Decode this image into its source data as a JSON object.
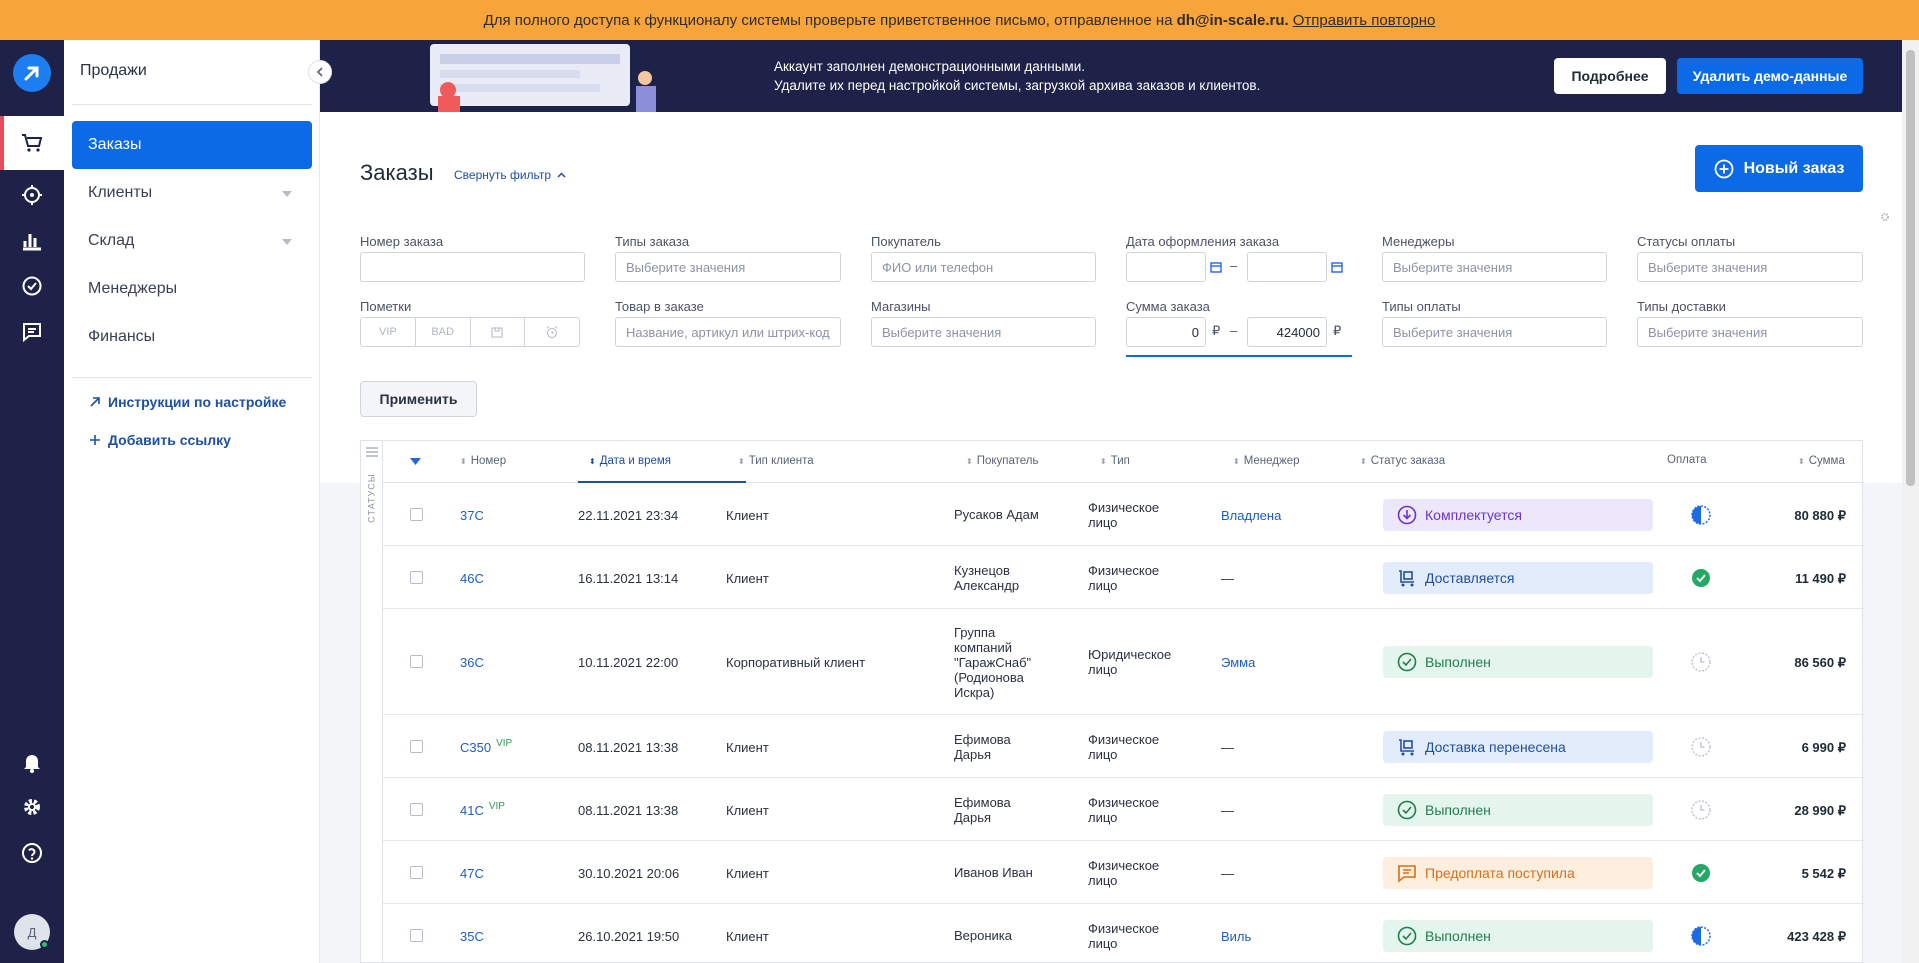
{
  "notice": {
    "text": "Для полного доступа к функционалу системы проверьте приветственное письмо, отправленное на",
    "email": "dh@in-scale.ru.",
    "resend": "Отправить повторно"
  },
  "sidebar": {
    "section": "Продажи",
    "items": [
      {
        "label": "Заказы"
      },
      {
        "label": "Клиенты"
      },
      {
        "label": "Склад"
      },
      {
        "label": "Менеджеры"
      },
      {
        "label": "Финансы"
      }
    ],
    "links": [
      {
        "label": "Инструкции по настройке"
      },
      {
        "label": "Добавить ссылку"
      }
    ]
  },
  "rail": {
    "avatar": "Д"
  },
  "banner": {
    "line1": "Аккаунт заполнен демонстрационными данными.",
    "line2": "Удалите их перед настройкой системы, загрузкой архива заказов и клиентов.",
    "more": "Подробнее",
    "delete": "Удалить демо-данные"
  },
  "page": {
    "title": "Заказы",
    "filter_toggle": "Свернуть фильтр",
    "new_order": "Новый заказ"
  },
  "filters": {
    "order_number": {
      "label": "Номер заказа",
      "placeholder": ""
    },
    "order_types": {
      "label": "Типы заказа",
      "placeholder": "Выберите значения"
    },
    "buyer": {
      "label": "Покупатель",
      "placeholder": "ФИО или телефон"
    },
    "date": {
      "label": "Дата оформления заказа",
      "sep": "–"
    },
    "managers": {
      "label": "Менеджеры",
      "placeholder": "Выберите значения"
    },
    "pay_statuses": {
      "label": "Статусы оплаты",
      "placeholder": "Выберите значения"
    },
    "marks": {
      "label": "Пометки",
      "vip": "VIP",
      "bad": "BAD"
    },
    "product": {
      "label": "Товар в заказе",
      "placeholder": "Название, артикул или штрих-код"
    },
    "shops": {
      "label": "Магазины",
      "placeholder": "Выберите значения"
    },
    "sum": {
      "label": "Сумма заказа",
      "from": "0",
      "to": "424000",
      "currency": "₽",
      "sep": "–"
    },
    "pay_types": {
      "label": "Типы оплаты",
      "placeholder": "Выберите значения"
    },
    "delivery_types": {
      "label": "Типы доставки",
      "placeholder": "Выберите значения"
    },
    "apply": "Применить"
  },
  "table": {
    "status_col": "СТАТУСЫ",
    "headers": {
      "number": "Номер",
      "datetime": "Дата и время",
      "client_type": "Тип клиента",
      "buyer": "Покупатель",
      "type": "Тип",
      "manager": "Менеджер",
      "status": "Статус заказа",
      "payment": "Оплата",
      "sum": "Сумма"
    },
    "rows": [
      {
        "number": "37C",
        "vip": "",
        "datetime": "22.11.2021 23:34",
        "client_type": "Клиент",
        "buyer": "Русаков Адам",
        "type": "Физическое лицо",
        "manager": "Владлена",
        "status": "Комплектуется",
        "status_kind": "violet",
        "payment": "partial",
        "sum": "80 880 ₽"
      },
      {
        "number": "46C",
        "vip": "",
        "datetime": "16.11.2021 13:14",
        "client_type": "Клиент",
        "buyer": "Кузнецов Александр",
        "type": "Физическое лицо",
        "manager": "—",
        "status": "Доставляется",
        "status_kind": "blue",
        "payment": "paid",
        "sum": "11 490 ₽"
      },
      {
        "number": "36C",
        "vip": "",
        "datetime": "10.11.2021 22:00",
        "client_type": "Корпоративный клиент",
        "buyer": "Группа компаний \"ГаражСнаб\" (Родионова Искра)",
        "type": "Юридическое лицо",
        "manager": "Эмма",
        "status": "Выполнен",
        "status_kind": "green",
        "payment": "pending",
        "sum": "86 560 ₽"
      },
      {
        "number": "C350",
        "vip": "VIP",
        "datetime": "08.11.2021 13:38",
        "client_type": "Клиент",
        "buyer": "Ефимова Дарья",
        "type": "Физическое лицо",
        "manager": "—",
        "status": "Доставка перенесена",
        "status_kind": "blue",
        "payment": "pending",
        "sum": "6 990 ₽"
      },
      {
        "number": "41C",
        "vip": "VIP",
        "datetime": "08.11.2021 13:38",
        "client_type": "Клиент",
        "buyer": "Ефимова Дарья",
        "type": "Физическое лицо",
        "manager": "—",
        "status": "Выполнен",
        "status_kind": "green",
        "payment": "pending",
        "sum": "28 990 ₽"
      },
      {
        "number": "47C",
        "vip": "",
        "datetime": "30.10.2021 20:06",
        "client_type": "Клиент",
        "buyer": "Иванов Иван",
        "type": "Физическое лицо",
        "manager": "—",
        "status": "Предоплата поступила",
        "status_kind": "orange",
        "payment": "paid",
        "sum": "5 542 ₽"
      },
      {
        "number": "35C",
        "vip": "",
        "datetime": "26.10.2021 19:50",
        "client_type": "Клиент",
        "buyer": "Вероника",
        "type": "Физическое лицо",
        "manager": "Виль",
        "status": "Выполнен",
        "status_kind": "green",
        "payment": "partial",
        "sum": "423 428 ₽"
      }
    ]
  }
}
